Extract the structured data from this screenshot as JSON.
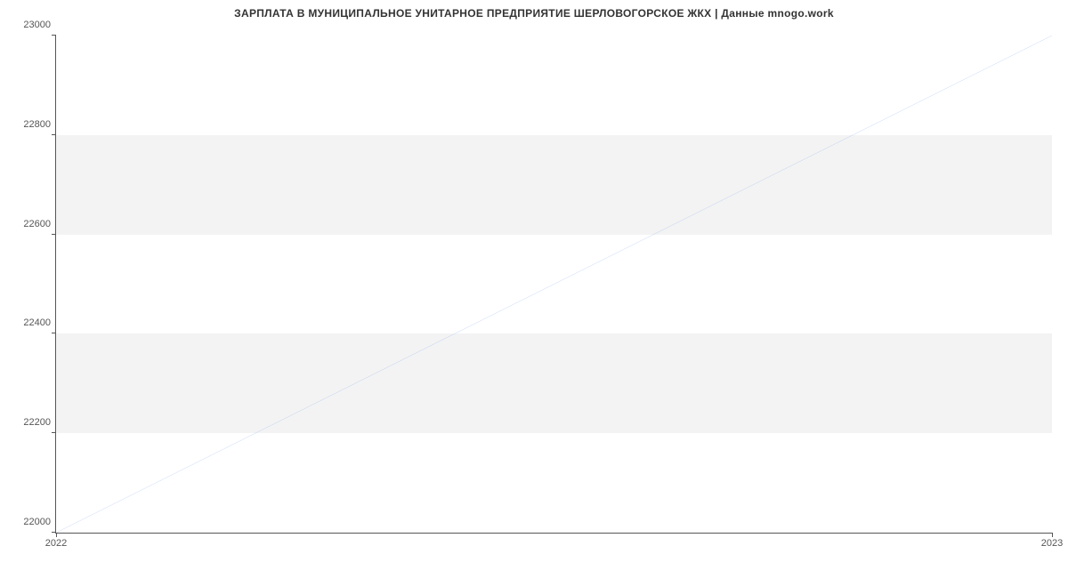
{
  "chart_data": {
    "type": "line",
    "title": "ЗАРПЛАТА В МУНИЦИПАЛЬНОЕ  УНИТАРНОЕ ПРЕДПРИЯТИЕ ШЕРЛОВОГОРСКОЕ ЖКХ | Данные mnogo.work",
    "x": [
      "2022",
      "2023"
    ],
    "y": [
      22000,
      23000
    ],
    "xlabel": "",
    "ylabel": "",
    "ylim": [
      22000,
      23000
    ],
    "y_ticks": [
      22000,
      22200,
      22400,
      22600,
      22800,
      23000
    ],
    "x_ticks": [
      "2022",
      "2023"
    ],
    "line_color": "#6495ed"
  },
  "ticks": {
    "y0": "22000",
    "y1": "22200",
    "y2": "22400",
    "y3": "22600",
    "y4": "22800",
    "y5": "23000",
    "x0": "2022",
    "x1": "2023"
  }
}
